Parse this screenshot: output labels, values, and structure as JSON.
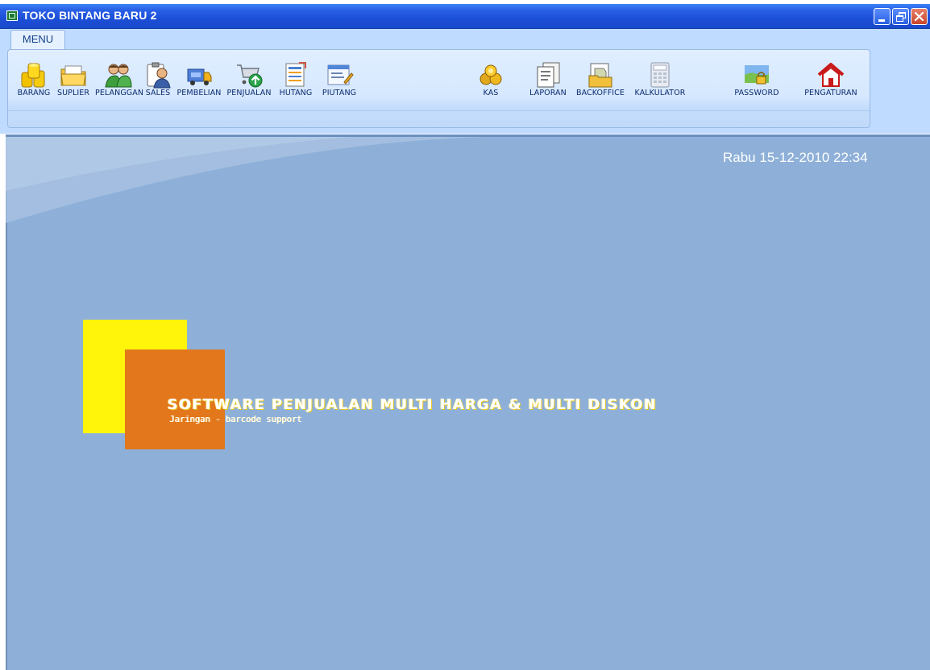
{
  "window": {
    "title": "TOKO BINTANG BARU 2",
    "controls": {
      "minimize": "minimize",
      "maximize": "restore",
      "close": "close"
    }
  },
  "ribbon": {
    "tab": "MENU",
    "items": [
      {
        "label": "BARANG",
        "icon": "coin-stack-icon"
      },
      {
        "label": "SUPLIER",
        "icon": "folder-icon"
      },
      {
        "label": "PELANGGAN",
        "icon": "people-icon"
      },
      {
        "label": "SALES",
        "icon": "salesperson-clipboard-icon"
      },
      {
        "label": "PEMBELIAN",
        "icon": "delivery-truck-icon"
      },
      {
        "label": "PENJUALAN",
        "icon": "shopping-cart-icon"
      },
      {
        "label": "HUTANG",
        "icon": "ledger-icon"
      },
      {
        "label": "PIUTANG",
        "icon": "form-edit-icon"
      },
      {
        "label": "KAS",
        "icon": "coins-icon"
      },
      {
        "label": "LAPORAN",
        "icon": "report-icon"
      },
      {
        "label": "BACKOFFICE",
        "icon": "document-folder-icon"
      },
      {
        "label": "KALKULATOR",
        "icon": "calculator-icon"
      },
      {
        "label": "PASSWORD",
        "icon": "password-lock-icon"
      },
      {
        "label": "PENGATURAN",
        "icon": "home-icon"
      }
    ]
  },
  "main": {
    "datetime": "Rabu  15-12-2010  22:34",
    "headline": "SOFTWARE PENJUALAN MULTI HARGA & MULTI DISKON",
    "subline": "Jaringan - barcode support"
  },
  "colors": {
    "titlebar": "#1b4fd8",
    "ribbon": "#bfdbff",
    "client_bg": "#8eb0d8",
    "yellow": "#fff50a",
    "orange": "#e2771c"
  }
}
